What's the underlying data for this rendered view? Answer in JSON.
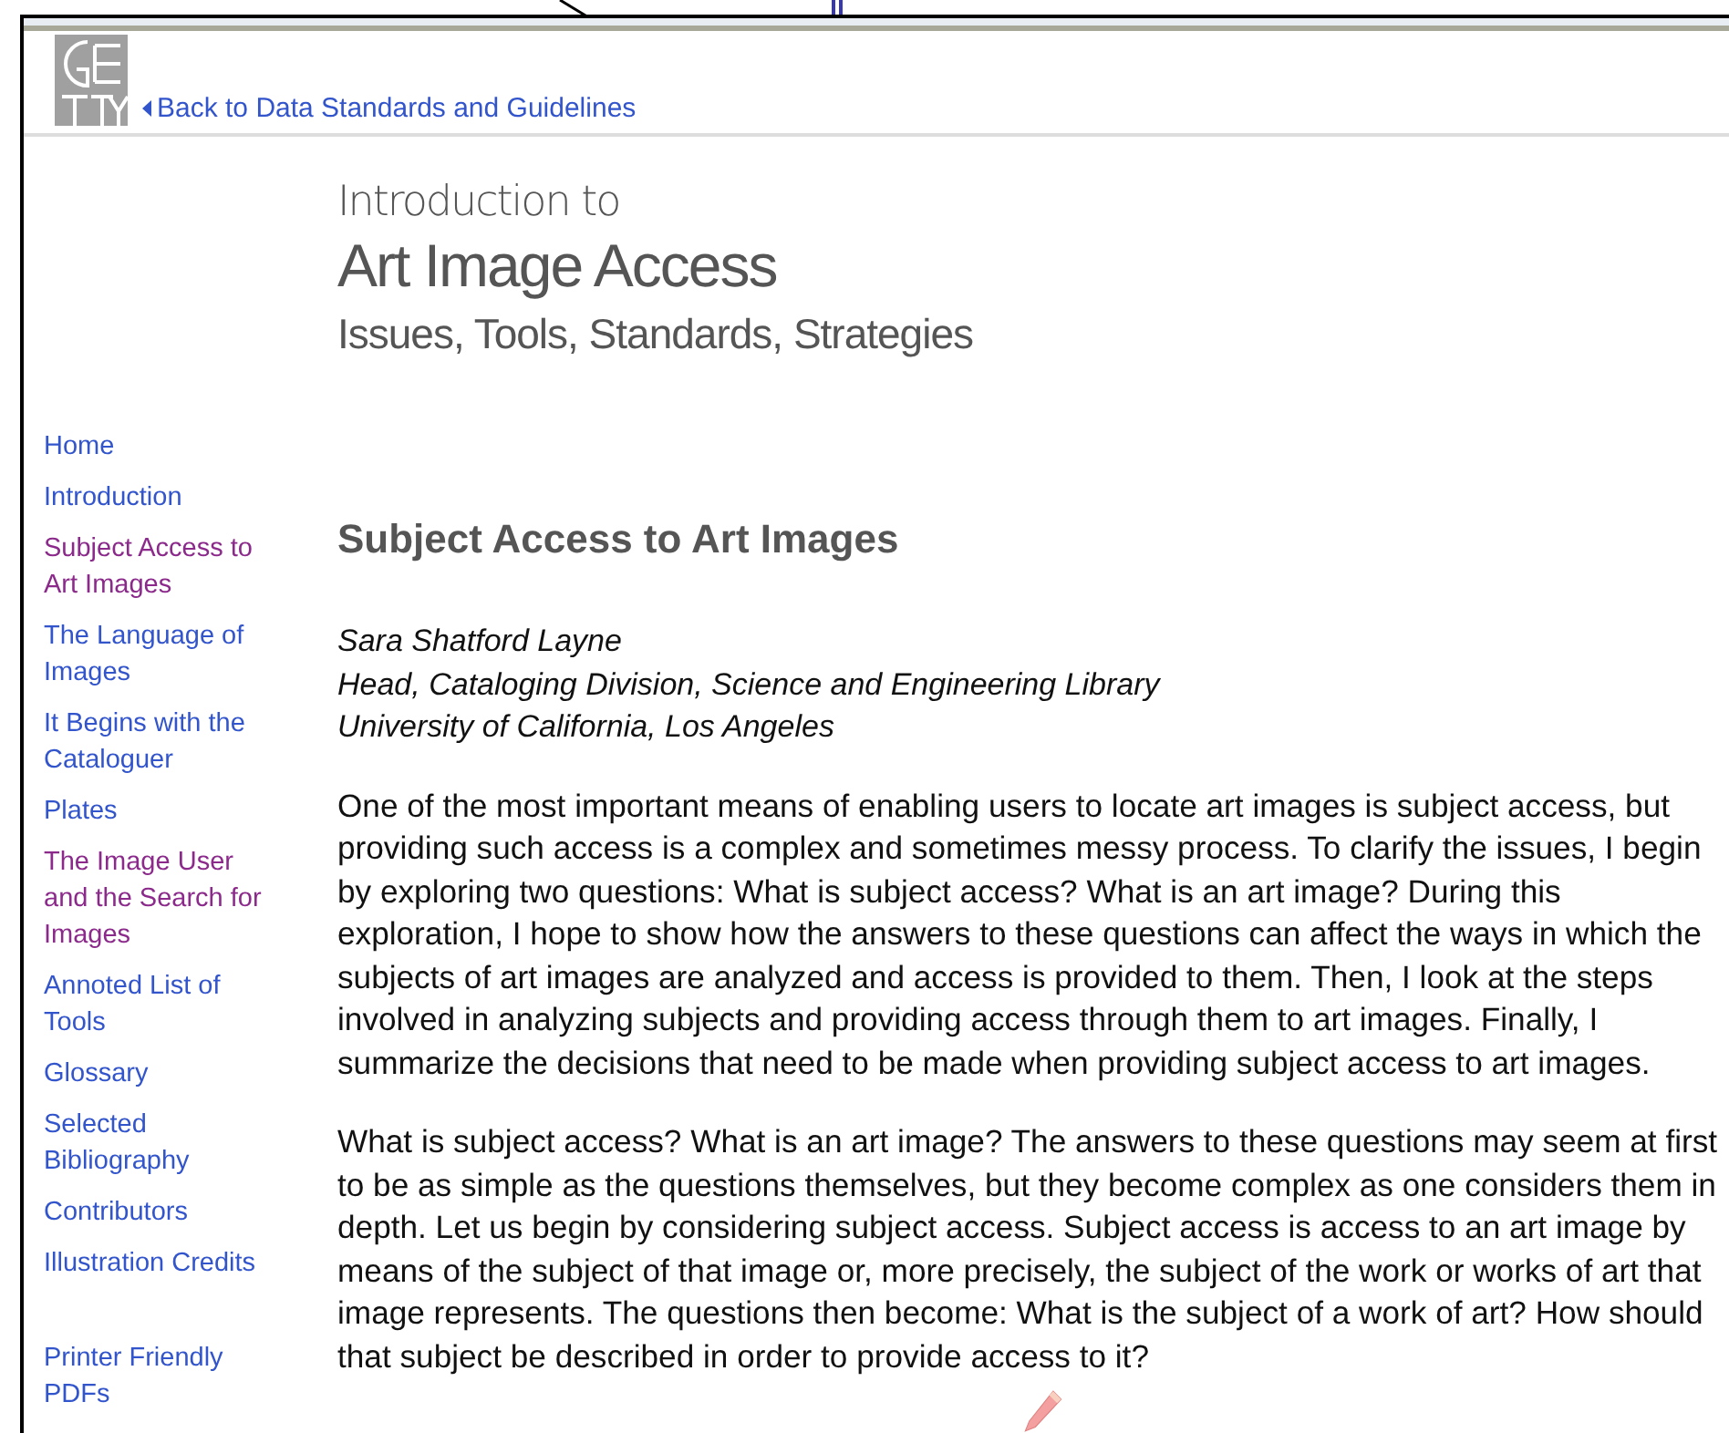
{
  "header": {
    "back_link": "Back to Data Standards and Guidelines"
  },
  "title_block": {
    "kicker": "Introduction to",
    "title": "Art Image Access",
    "subtitle": "Issues, Tools, Standards, Strategies"
  },
  "sidebar": {
    "items": [
      {
        "label": "Home",
        "visited": false
      },
      {
        "label": "Introduction",
        "visited": false
      },
      {
        "label": "Subject Access to Art Images",
        "visited": true
      },
      {
        "label": "The Language of Images",
        "visited": false
      },
      {
        "label": "It Begins with the Cataloguer",
        "visited": false
      },
      {
        "label": "Plates",
        "visited": false
      },
      {
        "label": "The Image User and the Search for Images",
        "visited": true
      },
      {
        "label": "Annoted List of Tools",
        "visited": false
      },
      {
        "label": "Glossary",
        "visited": false
      },
      {
        "label": "Selected Bibliography",
        "visited": false
      },
      {
        "label": "Contributors",
        "visited": false
      },
      {
        "label": "Illustration Credits",
        "visited": false
      }
    ],
    "extra_items": [
      {
        "label": "Printer Friendly PDFs",
        "visited": false
      }
    ]
  },
  "article": {
    "heading": "Subject Access to Art Images",
    "author": [
      "Sara Shatford Layne",
      "Head, Cataloging Division, Science and Engineering Library",
      "University of California, Los Angeles"
    ],
    "paragraphs": [
      "One of the most important means of enabling users to locate art images is subject access, but providing such access is a complex and sometimes messy process. To clarify the issues, I begin by exploring two questions: What is subject access? What is an art image? During this exploration, I hope to show how the answers to these questions can affect the ways in which the subjects of art images are analyzed and access is provided to them. Then, I look at the steps involved in analyzing subjects and providing access through them to art images. Finally, I summarize the decisions that need to be made when providing subject access to art images.",
      "What is subject access? What is an art image? The answers to these questions may seem at first to be as simple as the questions themselves, but they become complex as one considers them in depth. Let us begin by considering subject access. Subject access is access to an art image by means of the subject of that image or, more precisely, the subject of the work or works of art that image represents. The questions then become: What is the subject of a work of art? How should that subject be described in order to provide access to it?"
    ]
  }
}
